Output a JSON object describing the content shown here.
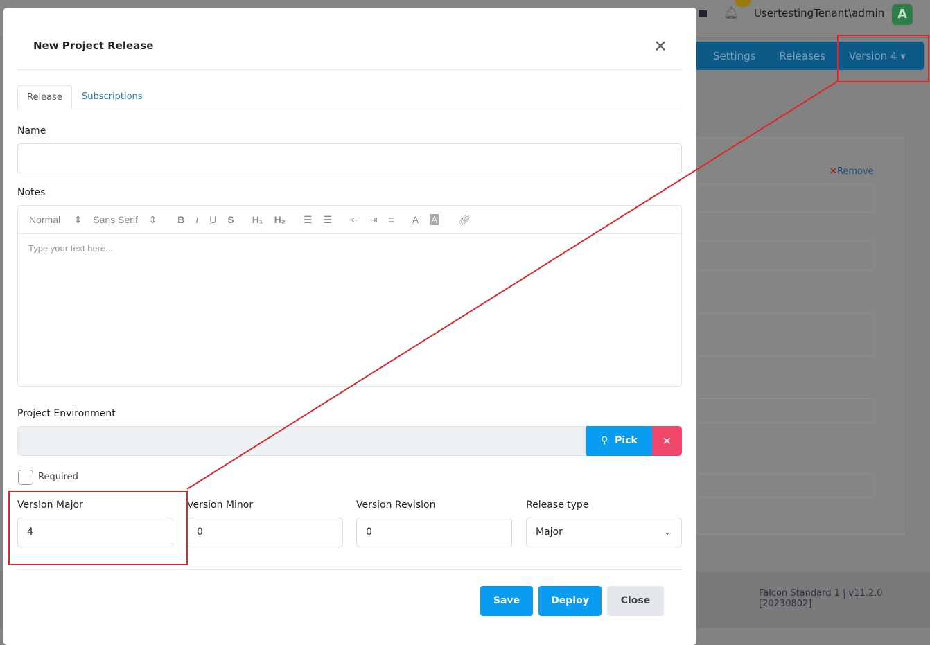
{
  "background": {
    "user": "UsertestingTenant\\admin",
    "avatar_letter": "A",
    "nav": [
      "Settings",
      "Releases",
      "Version 4 ▾"
    ],
    "remove_label": "Remove",
    "footer_version": "Falcon Standard 1 | v11.2.0 [20230802]"
  },
  "modal": {
    "title": "New Project Release",
    "tabs": [
      "Release",
      "Subscriptions"
    ],
    "name_label": "Name",
    "name_value": "",
    "notes_label": "Notes",
    "toolbar": {
      "header": "Normal",
      "font": "Sans Serif"
    },
    "notes_placeholder": "Type your text here...",
    "env_label": "Project Environment",
    "env_value": "",
    "pick_label": "Pick",
    "required_label": "Required",
    "required_checked": false,
    "fields": [
      {
        "label": "Version Major",
        "value": "4"
      },
      {
        "label": "Version Minor",
        "value": "0"
      },
      {
        "label": "Version Revision",
        "value": "0"
      },
      {
        "label": "Release type",
        "value": "Major"
      }
    ],
    "buttons": {
      "save": "Save",
      "deploy": "Deploy",
      "close": "Close"
    }
  },
  "colors": {
    "primary": "#0a9cf0",
    "danger": "#ef4669",
    "annotation": "#e0262b"
  }
}
